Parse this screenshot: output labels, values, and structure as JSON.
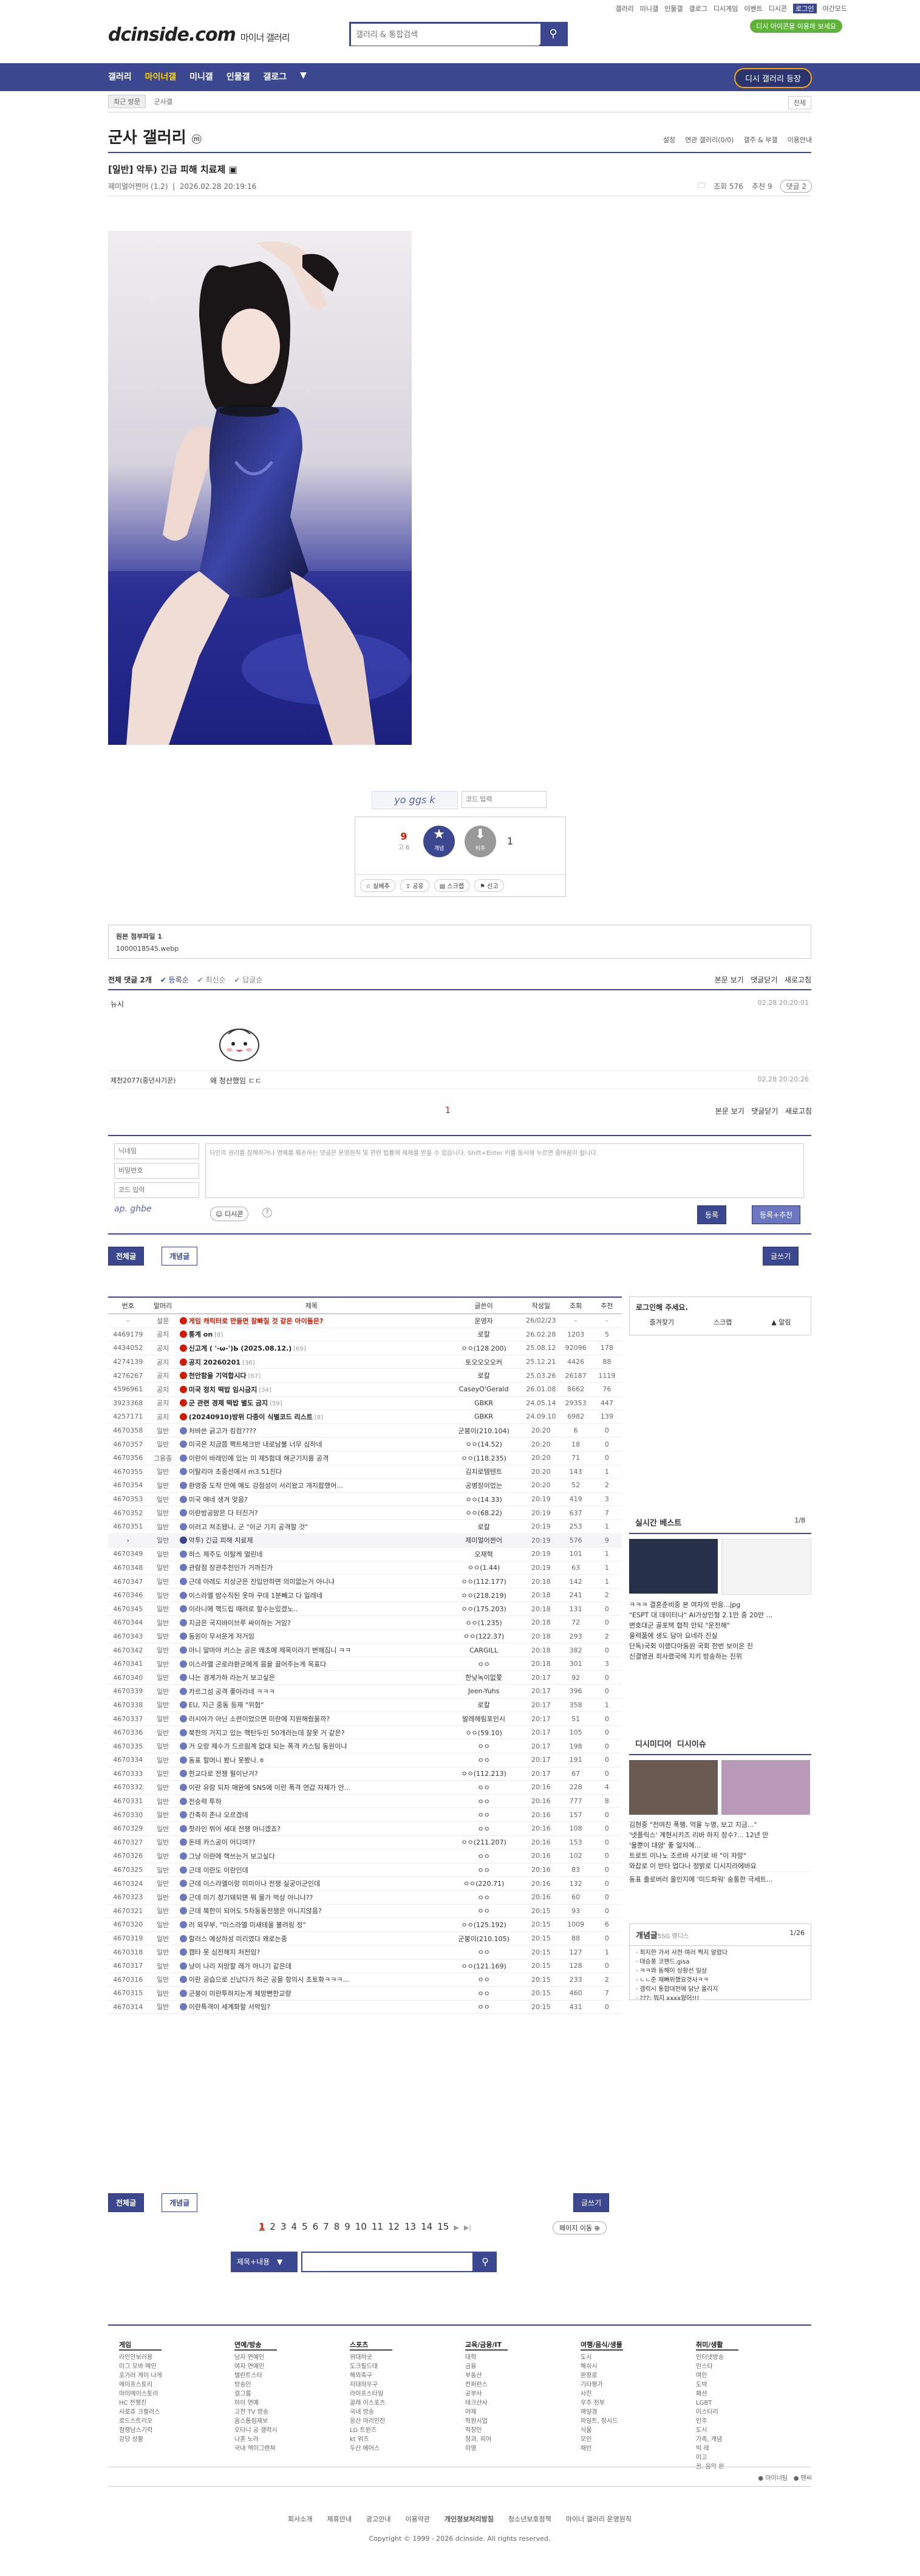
{
  "top_links": [
    "갤러리",
    "미니갤",
    "인물갤",
    "갤로그",
    "디시게임",
    "이벤트",
    "디시콘",
    "로그인",
    "야간모드"
  ],
  "site": {
    "logo": "dcinside.com",
    "logo_sub": "마이너 갤러리",
    "search_placeholder": "갤러리 & 통합검색",
    "green_badge": "디시 아이콘을 이용해 보세요"
  },
  "gnb": {
    "items": [
      "갤러리",
      "마이너갤",
      "미니갤",
      "인물갤",
      "갤로그"
    ],
    "open_button": "디시 갤러리 등장"
  },
  "subbar": {
    "recent": "최근 방문",
    "home": "군사갤",
    "toggle": "전체"
  },
  "gallery": {
    "title": "군사 갤러리",
    "mark": "ⓜ",
    "options": [
      "설정",
      "연관 갤러리(0/0)",
      "갤주 & 부갤",
      "이용안내"
    ]
  },
  "post": {
    "title": "[일반] 악투) 긴급 피해 치료제",
    "author": "제미얼어쩐어 (1.2)",
    "date": "2026.02.28 20:19:16",
    "views": "조회 576",
    "recommend": "추천 9",
    "comments": "댓글 2"
  },
  "captcha": {
    "text": "yo ggs k",
    "placeholder": "코드 입력"
  },
  "vote": {
    "up": "9",
    "up_fix": "고 6",
    "up_label": "개념",
    "down": "1",
    "down_label": "비추",
    "actions": [
      "실베추",
      "공유",
      "스크랩",
      "신고"
    ]
  },
  "attach": {
    "label": "원본 첨부파일 1",
    "file": "1000018545.webp"
  },
  "comment_header": {
    "all": "전체 댓글 2개",
    "opts": [
      "등록순",
      "최신순",
      "답글순"
    ],
    "right": [
      "본문 보기",
      "댓글닫기",
      "새로고침"
    ]
  },
  "comments": [
    {
      "author": "뉴시",
      "text": "",
      "date": "02.28 20:20:01",
      "has_dccon": true
    },
    {
      "author": "제천2077(중년사기꾼)",
      "text": "왜 청산했임 ㄷㄷ",
      "date": "02.28 20:20:26",
      "has_dccon": false
    }
  ],
  "comment_page": "1",
  "write": {
    "name_ph": "닉네임",
    "pw_ph": "비밀번호",
    "code_ph": "코드 입력",
    "body_ph": "타인의 권리를 침해하거나 명예를 훼손하는 댓글은 운영원칙 및 관련 법률에 제재를 받을 수 있습니다. Shift+Enter 키를 동시에 누르면 줄바꿈이 됩니다.",
    "captcha_text": "ap. ghbe",
    "dccon": "디시콘",
    "submit": "등록",
    "submit_rec": "등록+추천"
  },
  "list_tabs": {
    "all": "전체글",
    "concept": "개념글",
    "write": "글쓰기"
  },
  "list_headers": [
    "번호",
    "말머리",
    "제목",
    "글쓴이",
    "작성일",
    "조회",
    "추천"
  ],
  "rows": [
    {
      "no": "-",
      "head": "설문",
      "title": "게임 캐릭터로 만들면 잘빠질 것 같은 아이돌은?",
      "writer": "운영자",
      "date": "26/02/23",
      "views": "-",
      "rec": "-",
      "kind": "survey"
    },
    {
      "no": "4469179",
      "head": "공지",
      "title": "통계 on",
      "cnt": "[8]",
      "writer": "로칼",
      "date": "26.02.28",
      "views": "1203",
      "rec": "5",
      "kind": "notice"
    },
    {
      "no": "4434052",
      "head": "공지",
      "title": "신고게 ( '-ω-')Ь (2025.08.12.)",
      "cnt": "[69]",
      "writer": "ㅇㅇ(128.200)",
      "date": "25.08.12",
      "views": "92096",
      "rec": "178",
      "kind": "notice"
    },
    {
      "no": "4274139",
      "head": "공지",
      "title": "공지 20260201",
      "cnt": "[36]",
      "writer": "토오오오오커",
      "date": "25.12.21",
      "views": "4426",
      "rec": "88",
      "kind": "notice"
    },
    {
      "no": "4276267",
      "head": "공지",
      "title": "천안함을 기억합시다",
      "cnt": "[67]",
      "writer": "로칼",
      "date": "25.03.26",
      "views": "26187",
      "rec": "1119",
      "kind": "notice"
    },
    {
      "no": "4596961",
      "head": "공지",
      "title": "미국 정치 떡밥 임시금지",
      "cnt": "[34]",
      "writer": "CaseyO'Gerald",
      "date": "26.01.08",
      "views": "8662",
      "rec": "76",
      "kind": "notice"
    },
    {
      "no": "3923368",
      "head": "공지",
      "title": "군 관련 경제 떡밥 별도 금지",
      "cnt": "[59]",
      "writer": "GBKR",
      "date": "24.05.14",
      "views": "29353",
      "rec": "447",
      "kind": "notice"
    },
    {
      "no": "4257171",
      "head": "공지",
      "title": "(20240910)방위 다중이 식별코드 리스트",
      "cnt": "[8]",
      "writer": "GBKR",
      "date": "24.09.10",
      "views": "6982",
      "rec": "139",
      "kind": "notice"
    },
    {
      "no": "4670358",
      "head": "일반",
      "title": "처바쓴 긁고가 킹컴????",
      "writer": "군붕이(210.104)",
      "date": "20:20",
      "views": "6",
      "rec": "0",
      "kind": "normal"
    },
    {
      "no": "4670357",
      "head": "일반",
      "title": "미국은 지금쯤 팩트체크반 내로남불 너무 심하네",
      "writer": "ㅇㅇ(14.52)",
      "date": "20:20",
      "views": "18",
      "rec": "0",
      "kind": "normal"
    },
    {
      "no": "4670356",
      "head": "그용종",
      "title": "이란이 바레인에 있는 미 제5함대 해군기지를 공격",
      "writer": "ㅇㅇ(118.235)",
      "date": "20:20",
      "views": "71",
      "rec": "0",
      "kind": "normal"
    },
    {
      "no": "4670355",
      "head": "일반",
      "title": "이탈리아 초중선에서 m3.51진다",
      "writer": "김치로템텐트",
      "date": "20:20",
      "views": "143",
      "rec": "1",
      "kind": "normal"
    },
    {
      "no": "4670354",
      "head": "일반",
      "title": "환영중 도착 만에 예도 강점성이 서리왔고 개지팝했어...",
      "writer": "공병장이었는",
      "date": "20:20",
      "views": "52",
      "rec": "2",
      "kind": "normal"
    },
    {
      "no": "4670353",
      "head": "일반",
      "title": "미국 애네 생겨 맞음?",
      "writer": "ㅇㅇ(14.33)",
      "date": "20:19",
      "views": "419",
      "rec": "3",
      "kind": "normal"
    },
    {
      "no": "4670352",
      "head": "일반",
      "title": "이란방공망은 다 터진거?",
      "writer": "ㅇㅇ(68.22)",
      "date": "20:19",
      "views": "637",
      "rec": "7",
      "kind": "normal"
    },
    {
      "no": "4670351",
      "head": "일반",
      "title": "이러고 쳐조됐나, 군 \"이군 기지 공격할 것\"",
      "writer": "로칼",
      "date": "20:19",
      "views": "253",
      "rec": "1",
      "kind": "normal"
    },
    {
      "no": "current",
      "head": "일반",
      "title": "악투) 긴급 피해 치료제",
      "writer": "제미얼어쩐어",
      "date": "20:19",
      "views": "576",
      "rec": "9",
      "kind": "current"
    },
    {
      "no": "4670349",
      "head": "일반",
      "title": "하스 제주도 이탈케 멀린네",
      "writer": "오재혁",
      "date": "20:19",
      "views": "101",
      "rec": "1",
      "kind": "normal"
    },
    {
      "no": "4670348",
      "head": "일반",
      "title": "관람점 장관추천인가 거까진가",
      "writer": "ㅇㅇ(1.44)",
      "date": "20:19",
      "views": "63",
      "rec": "1",
      "kind": "normal"
    },
    {
      "no": "4670347",
      "head": "일반",
      "title": "근데 아레도 지상군은 진입안하면 의미없는거 아니냐",
      "writer": "ㅇㅇ(112.177)",
      "date": "20:18",
      "views": "142",
      "rec": "1",
      "kind": "normal"
    },
    {
      "no": "4670346",
      "head": "일반",
      "title": "이스라엘 밤수직된 옷마 꾸데 1분빼고 다 일레네",
      "writer": "ㅇㅇ(218.219)",
      "date": "20:18",
      "views": "241",
      "rec": "2",
      "kind": "normal"
    },
    {
      "no": "4670345",
      "head": "일반",
      "title": "이라니에 핵드립 때려로 할수는있겠노..",
      "writer": "ㅇㅇ(175.203)",
      "date": "20:18",
      "views": "131",
      "rec": "0",
      "kind": "normal"
    },
    {
      "no": "4670344",
      "head": "일반",
      "title": "지금은 국지바이브루 싸이하는 거임?",
      "writer": "ㅇㅇ(1.235)",
      "date": "20:18",
      "views": "72",
      "rec": "0",
      "kind": "normal"
    },
    {
      "no": "4670343",
      "head": "일반",
      "title": "동원이 무서운게 저거임",
      "writer": "ㅇㅇ(122.37)",
      "date": "20:18",
      "views": "293",
      "rec": "2",
      "kind": "normal"
    },
    {
      "no": "4670342",
      "head": "일반",
      "title": "아니 말마야 키스는 공은 왜초에 제목이라기 변해짐니 ㅋㅋ",
      "writer": "CARGILL",
      "date": "20:18",
      "views": "382",
      "rec": "0",
      "kind": "normal"
    },
    {
      "no": "4670341",
      "head": "일반",
      "title": "이스라엘 곤로라환군에게 음을 끌어주는게 목표다",
      "writer": "ㅇㅇ",
      "date": "20:18",
      "views": "301",
      "rec": "3",
      "kind": "normal"
    },
    {
      "no": "4670340",
      "head": "일반",
      "title": "나는 경계가하 라는거 보고싶은",
      "writer": "한낮녹이없쫓",
      "date": "20:17",
      "views": "92",
      "rec": "0",
      "kind": "normal"
    },
    {
      "no": "4670339",
      "head": "일반",
      "title": "카르그섬 공격 좋아라네 ㅋㅋㅋ",
      "writer": "Jeen-Yuhs",
      "date": "20:17",
      "views": "396",
      "rec": "0",
      "kind": "normal"
    },
    {
      "no": "4670338",
      "head": "일반",
      "title": "EU, 지근 중동 등재 \"위험\"",
      "writer": "로칼",
      "date": "20:17",
      "views": "358",
      "rec": "1",
      "kind": "normal"
    },
    {
      "no": "4670337",
      "head": "일반",
      "title": "러시아가 아닌 소련이었으면 미란에 지원해줬을까?",
      "writer": "발레헤림포인시",
      "date": "20:17",
      "views": "51",
      "rec": "0",
      "kind": "normal"
    },
    {
      "no": "4670336",
      "head": "일반",
      "title": "북한의 거지고 있는 핵탄두인 50개라는데 잘못 거 같은?",
      "writer": "ㅇㅇ(59.10)",
      "date": "20:17",
      "views": "105",
      "rec": "0",
      "kind": "normal"
    },
    {
      "no": "4670335",
      "head": "일반",
      "title": "거 오랑 제수가 드르림계 없대 되는 폭격 카스팀 동원이냐",
      "writer": "ㅇㅇ",
      "date": "20:17",
      "views": "198",
      "rec": "0",
      "kind": "normal"
    },
    {
      "no": "4670334",
      "head": "일반",
      "title": "동표 할머니 봤나 못봤나.ㅎ",
      "writer": "ㅇㅇ",
      "date": "20:17",
      "views": "191",
      "rec": "0",
      "kind": "normal"
    },
    {
      "no": "4670333",
      "head": "일반",
      "title": "한교다로 전쟁 필이난거?",
      "writer": "ㅇㅇ(112.213)",
      "date": "20:17",
      "views": "67",
      "rec": "0",
      "kind": "normal"
    },
    {
      "no": "4670332",
      "head": "일반",
      "title": "이란 유람 되자 매완에 SNS에 이런 폭격 연갑 자체가 안...",
      "writer": "ㅇㅇ",
      "date": "20:16",
      "views": "228",
      "rec": "4",
      "kind": "normal"
    },
    {
      "no": "4670331",
      "head": "일반",
      "title": "전승력 투하",
      "writer": "ㅇㅇ",
      "date": "20:16",
      "views": "777",
      "rec": "8",
      "kind": "normal"
    },
    {
      "no": "4670330",
      "head": "일반",
      "title": "간축히 존나 오르겠네",
      "writer": "ㅇㅇ",
      "date": "20:16",
      "views": "157",
      "rec": "0",
      "kind": "normal"
    },
    {
      "no": "4670329",
      "head": "일반",
      "title": "핫라인 뛰어 세대 전쟁 아니겠죠?",
      "writer": "ㅇㅇ",
      "date": "20:16",
      "views": "108",
      "rec": "0",
      "kind": "normal"
    },
    {
      "no": "4670327",
      "head": "일반",
      "title": "돈테 카스공이 어디여??",
      "writer": "ㅇㅇ(211.207)",
      "date": "20:16",
      "views": "153",
      "rec": "0",
      "kind": "normal"
    },
    {
      "no": "4670326",
      "head": "일반",
      "title": "그냥 이란에 핵쓰는거 보고싶다",
      "writer": "ㅇㅇ",
      "date": "20:16",
      "views": "102",
      "rec": "0",
      "kind": "normal"
    },
    {
      "no": "4670325",
      "head": "일반",
      "title": "근데 이란도 이란인데",
      "writer": "ㅇㅇ",
      "date": "20:16",
      "views": "83",
      "rec": "0",
      "kind": "normal"
    },
    {
      "no": "4670324",
      "head": "일반",
      "title": "근데 이스라엘이랑 미미이나 전쟁 실궁이군인데",
      "writer": "ㅇㅇ(220.71)",
      "date": "20:16",
      "views": "132",
      "rec": "0",
      "kind": "normal"
    },
    {
      "no": "4670323",
      "head": "일반",
      "title": "근데 미기 정기돼되면 뭐 물가 먹상 아니냐??",
      "writer": "ㅇㅇ",
      "date": "20:16",
      "views": "60",
      "rec": "0",
      "kind": "normal"
    },
    {
      "no": "4670321",
      "head": "일반",
      "title": "근데 북한이 되어도 5차동동전쟁은 아니지않음?",
      "writer": "ㅇㅇ",
      "date": "20:15",
      "views": "93",
      "rec": "0",
      "kind": "normal"
    },
    {
      "no": "4670320",
      "head": "일반",
      "title": "러 외무부, \"미스라엘 미새테올 불려링 정\"",
      "writer": "ㅇㅇ(125.192)",
      "date": "20:15",
      "views": "1009",
      "rec": "6",
      "kind": "normal"
    },
    {
      "no": "4670319",
      "head": "일반",
      "title": "할러스 예상하성 미리였다 왜로는중",
      "writer": "군붕이(210.105)",
      "date": "20:15",
      "views": "88",
      "rec": "0",
      "kind": "normal"
    },
    {
      "no": "4670318",
      "head": "일반",
      "title": "캠타 못 심전해지 처전임?",
      "writer": "ㅇㅇ",
      "date": "20:15",
      "views": "127",
      "rec": "1",
      "kind": "normal"
    },
    {
      "no": "4670317",
      "head": "일반",
      "title": "냥이 나리 저망할 래가 아니기 같은데",
      "writer": "ㅇㅇ(121.169)",
      "date": "20:15",
      "views": "128",
      "rec": "0",
      "kind": "normal"
    },
    {
      "no": "4670316",
      "head": "일반",
      "title": "이란 공습으로 신났다가 하곤 공을 항의시 초토화ㅋㅋㅋ...",
      "writer": "ㅇㅇ",
      "date": "20:15",
      "views": "233",
      "rec": "2",
      "kind": "normal"
    },
    {
      "no": "4670315",
      "head": "일반",
      "title": "군붕이 미란투하지는게 체망뻔한교량",
      "writer": "ㅇㅇ",
      "date": "20:15",
      "views": "460",
      "rec": "7",
      "kind": "normal"
    },
    {
      "no": "4670314",
      "head": "일반",
      "title": "이란특격이 세계화할 서막임?",
      "writer": "ㅇㅇ",
      "date": "20:15",
      "views": "431",
      "rec": "0",
      "kind": "normal"
    }
  ],
  "pager": {
    "pages": [
      "1",
      "2",
      "3",
      "4",
      "5",
      "6",
      "7",
      "8",
      "9",
      "10",
      "11",
      "12",
      "13",
      "14",
      "15"
    ],
    "next": "▶",
    "last": "▶|",
    "move": "페이지 이동"
  },
  "list_search": {
    "select": "제목+내용",
    "placeholder": ""
  },
  "side": {
    "login": "로그인해 주세요.",
    "login_items": [
      "즐겨찾기",
      "스크랩",
      "알림"
    ],
    "realtime": "실시간 베스트",
    "realtime_page": "1/8",
    "realtime_items": [
      "ㅋㅋㅋ 결혼준비중 본 여자의 반응...jpg",
      "\"ESPT 대 데이터나\" AI가상인형 2.1만 중 20만 ...",
      "변호대군 골포택 협착 안되 \"운전해\"",
      "울력품에 생도 담아 요네라 진실",
      "단독)국회 이랬다아동원 국회 한번 보이온 진",
      "신결명권 죄사랬국에 지키 방송하는 진위"
    ],
    "dcinside": "디시미디어",
    "dcinside2": "디시이슈",
    "dc_items": [
      "김현중 \"전여친 폭행, 억울 누명, 보고 지금...\"",
      "'넷플릭스' 계현시키즈 리바 하지 장수?... 12년 만",
      "'물뿐이 대양' 좋 일지에...",
      "트로트 이나노 조르바 사기로 바 \"이 차망\"",
      "와잡로 이 반타 업다나 정밝로 디시지라에바요"
    ],
    "dc_bottom": "동표 출로버러 올인지에 '미드파워' 숭통한 극세트...",
    "concept": "개념글",
    "concept_sub": "5SG 랭디스",
    "concept_page": "1/26",
    "concept_items": [
      "최지한 가서 사전 여러 찍지 알렸다",
      "대승풍 코팬드.gisa",
      "ㅋㅋ와 동해이 상황선 일삼",
      "ㄴㄴ준 재뻐위했요것사ㅋㅋ",
      "갤럭시 통합대전에 닭난 올리지",
      "???: 뭐지 xxxx왕어!!!"
    ]
  },
  "footer": {
    "cols": [
      {
        "h": "게임",
        "items": [
          "라인안보러용",
          "미그 모바 메인",
          "포가러 게이 나게",
          "메이프스토리",
          "마이메이스토리",
          "HC 전쟁진",
          "사로쥬 크팔러스",
          "로드스트리오",
          "점쟁남스기럭",
          "강당 상활"
        ]
      },
      {
        "h": "연예/방송",
        "items": [
          "남자 연예인",
          "여자 연예인",
          "탤런트스타",
          "방송인",
          "걸그룹",
          "하이 연예",
          "고전 TV 방송",
          "움스톰림재보",
          "오타니 공 갤럭시",
          "나혼 노라",
          "국내 엑이그렌쳐"
        ]
      },
      {
        "h": "스포츠",
        "items": [
          "위대하굿",
          "도크필드대",
          "해외축구",
          "지대하우구",
          "라이프스타일",
          "골레 이스포츠",
          "국내 방송",
          "응산 마리인진",
          "LG 트윈즈",
          "kt 위즈",
          "두산 베어스"
        ]
      },
      {
        "h": "교육/금융/IT",
        "items": [
          "대학",
          "금융",
          "부동산",
          "컨퍼런스",
          "공부사",
          "테크산사",
          "야제",
          "학원시업",
          "직장인",
          "청과, 피어",
          "미영"
        ]
      },
      {
        "h": "여행/음식/생물",
        "items": [
          "도시",
          "해쉬시",
          "판정로",
          "기타평가",
          "사진",
          "우주 천부",
          "매일경",
          "파일트, 장시드",
          "식물",
          "모인",
          "채빈"
        ]
      },
      {
        "h": "취미/생활",
        "items": [
          "인터넷방송",
          "인스타",
          "여인",
          "도박",
          "패션",
          "LGBT",
          "미스터리",
          "인주",
          "도시",
          "가족, 개념",
          "빅 레",
          "미고",
          "꿈. 음악 원"
        ]
      }
    ],
    "bottom_right": [
      "마이너팀",
      "텐씨"
    ],
    "links": [
      "회사소개",
      "제휴안내",
      "광고안내",
      "이용약관",
      "개인정보처리방침",
      "청소년보호정책",
      "마이너 갤러리 운영원칙"
    ],
    "copyright": "Copyright © 1999 - 2026 dcinside. All rights reserved."
  },
  "colors": {
    "primary": "#3b4890",
    "notice_red": "#d31900",
    "accent": "#ffd400"
  }
}
